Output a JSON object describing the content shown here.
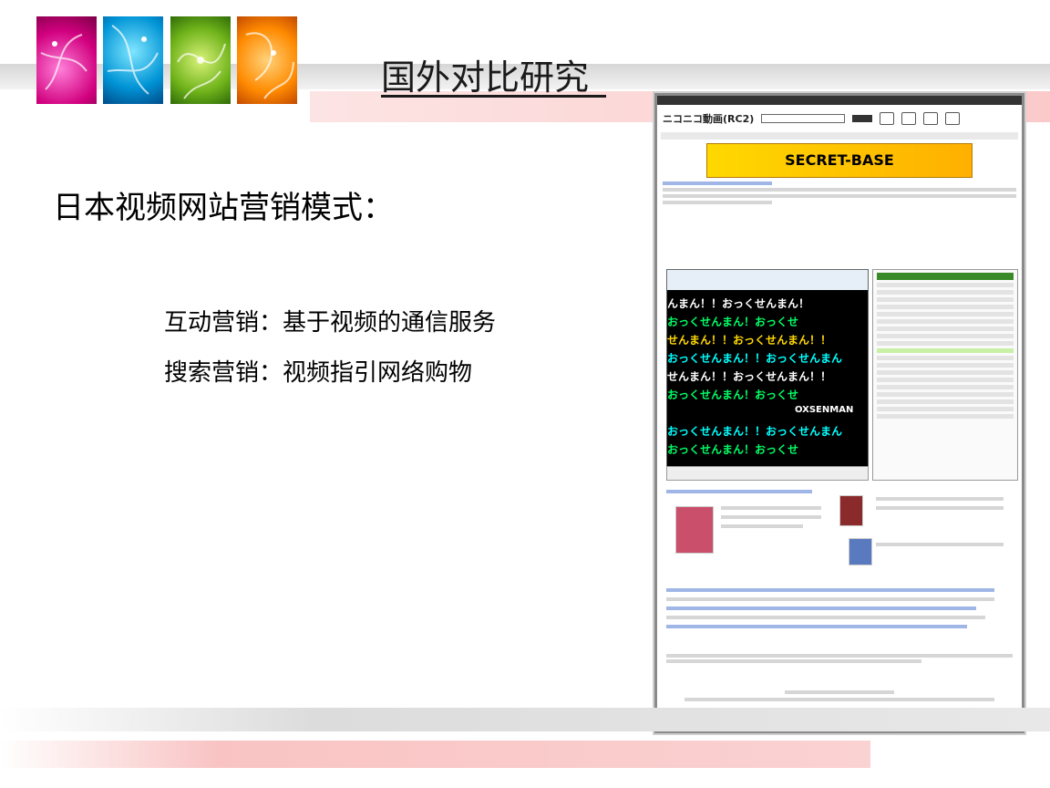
{
  "slide": {
    "title": "国外对比研究_",
    "heading": "日本视频网站营销模式：",
    "bullets": [
      "互动营销：基于视频的通信服务",
      "搜索营销：视频指引网络购物"
    ]
  },
  "screenshot": {
    "site_logo": "ニコニコ動画(RC2)",
    "banner": "SECRET-BASE",
    "danmaku": [
      "んまん！！おっくせんまん！",
      "おっくせんまん！おっくせ",
      "せんまん！！おっくせんまん！！",
      "おっくせんまん！！おっくせんまん",
      "OXSENMAN"
    ]
  },
  "colors": {
    "deco_pink": "#d1007e",
    "deco_blue": "#0094d6",
    "deco_green": "#6fb31a",
    "deco_orange": "#ff8a00"
  }
}
